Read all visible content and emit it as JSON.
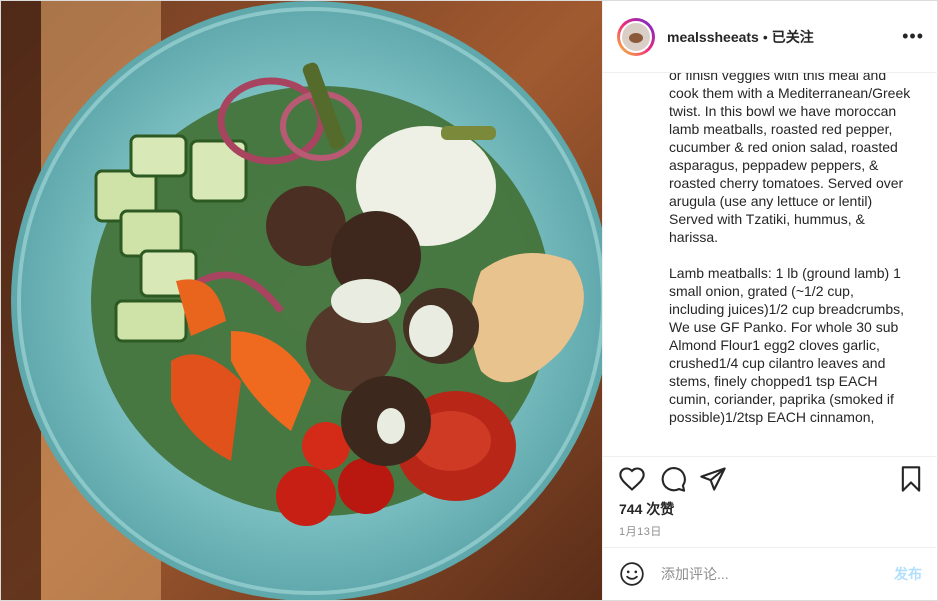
{
  "post": {
    "image_description": "",
    "username": "mealssheeats",
    "separator": "•",
    "follow_status": "已关注",
    "more_icon": "more-horizontal-icon",
    "caption": "or finish veggies with this meal and cook them with a Mediterranean/Greek twist. In this bowl we have moroccan lamb meatballs, roasted red pepper, cucumber & red onion salad, roasted asparagus, peppadew peppers, & roasted cherry tomatoes. Served over arugula (use any lettuce or lentil) Served with Tzatiki, hummus, & harissa.\n\nLamb meatballs: 1 lb (ground lamb) 1 small onion, grated (~1/2 cup, including juices)1/2 cup breadcrumbs, We use GF Panko. For whole 30 sub Almond Flour1 egg2 cloves garlic, crushed1/4 cup cilantro leaves and stems, finely chopped1 tsp EACH cumin, coriander, paprika (smoked if possible)1/2tsp EACH cinnamon,",
    "likes": "744 次赞",
    "date": "1月13日"
  },
  "actions": {
    "icons": [
      "heart-icon",
      "comment-icon",
      "share-icon",
      "bookmark-icon"
    ]
  },
  "comment": {
    "placeholder": "添加评论...",
    "post_label": "发布"
  }
}
